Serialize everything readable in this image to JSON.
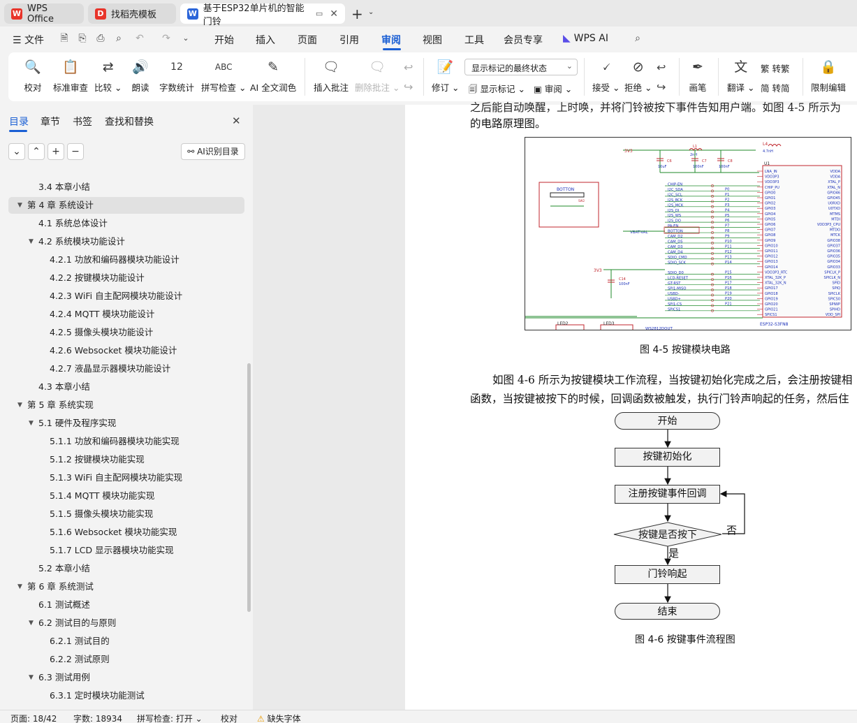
{
  "tabs": [
    {
      "label": "WPS Office",
      "logo": "W",
      "color": "#e8342a"
    },
    {
      "label": "找稻壳模板",
      "logo": "D",
      "color": "#e8342a"
    },
    {
      "label": "基于ESP32单片机的智能门铃",
      "logo": "W",
      "color": "#2b65d9"
    }
  ],
  "menu": {
    "file": "文件",
    "items": [
      "开始",
      "插入",
      "页面",
      "引用",
      "审阅",
      "视图",
      "工具",
      "会员专享"
    ],
    "wps_ai": "WPS AI"
  },
  "ribbon": {
    "proofread": "校对",
    "standard_review": "标准审查",
    "compare": "比较",
    "read_aloud": "朗读",
    "word_count": "字数统计",
    "spell_check": "拼写检查",
    "ai_polish": "AI 全文润色",
    "insert_comment": "插入批注",
    "delete_comment": "删除批注",
    "revise": "修订",
    "markup_select": "显示标记的最终状态",
    "show_markup": "显示标记",
    "review": "审阅",
    "accept": "接受",
    "reject": "拒绝",
    "brush": "画笔",
    "translate": "翻译",
    "to_traditional": "转繁",
    "to_simplified": "转简",
    "restrict_edit": "限制编辑",
    "abc_icon_text": "ABC",
    "count_icon_text": "12"
  },
  "panel": {
    "tabs": [
      "目录",
      "章节",
      "书签",
      "查找和替换"
    ],
    "ai_toc": "AI识别目录",
    "toc": [
      {
        "text": "3.4   本章小结",
        "level": 1,
        "caret": ""
      },
      {
        "text": "第 4 章    系统设计",
        "level": 0,
        "caret": "▼",
        "selected": true
      },
      {
        "text": "4.1    系统总体设计",
        "level": 1,
        "caret": ""
      },
      {
        "text": "4.2    系统模块功能设计",
        "level": 1,
        "caret": "▼"
      },
      {
        "text": "4.2.1    功放和编码器模块功能设计",
        "level": 2,
        "caret": ""
      },
      {
        "text": "4.2.2    按键模块功能设计",
        "level": 2,
        "caret": ""
      },
      {
        "text": "4.2.3    WiFi 自主配网模块功能设计",
        "level": 2,
        "caret": ""
      },
      {
        "text": "4.2.4    MQTT 模块功能设计",
        "level": 2,
        "caret": ""
      },
      {
        "text": "4.2.5    摄像头模块功能设计",
        "level": 2,
        "caret": ""
      },
      {
        "text": "4.2.6    Websocket 模块功能设计",
        "level": 2,
        "caret": ""
      },
      {
        "text": "4.2.7    液晶显示器模块功能设计",
        "level": 2,
        "caret": ""
      },
      {
        "text": "4.3    本章小结",
        "level": 1,
        "caret": ""
      },
      {
        "text": "第 5 章    系统实现",
        "level": 0,
        "caret": "▼"
      },
      {
        "text": "5.1    硬件及程序实现",
        "level": 1,
        "caret": "▼"
      },
      {
        "text": "5.1.1  功放和编码器模块功能实现",
        "level": 2,
        "caret": ""
      },
      {
        "text": "5.1.2    按键模块功能实现",
        "level": 2,
        "caret": ""
      },
      {
        "text": "5.1.3    WiFi 自主配网模块功能实现",
        "level": 2,
        "caret": ""
      },
      {
        "text": "5.1.4    MQTT 模块功能实现",
        "level": 2,
        "caret": ""
      },
      {
        "text": "5.1.5    摄像头模块功能实现",
        "level": 2,
        "caret": ""
      },
      {
        "text": "5.1.6    Websocket 模块功能实现",
        "level": 2,
        "caret": ""
      },
      {
        "text": "5.1.7    LCD 显示器模块功能实现",
        "level": 2,
        "caret": ""
      },
      {
        "text": "5.2    本章小结",
        "level": 1,
        "caret": ""
      },
      {
        "text": "第 6 章    系统测试",
        "level": 0,
        "caret": "▼"
      },
      {
        "text": "6.1    测试概述",
        "level": 1,
        "caret": ""
      },
      {
        "text": "6.2    测试目的与原则",
        "level": 1,
        "caret": "▼"
      },
      {
        "text": "6.2.1    测试目的",
        "level": 2,
        "caret": ""
      },
      {
        "text": "6.2.2    测试原则",
        "level": 2,
        "caret": ""
      },
      {
        "text": "6.3    测试用例",
        "level": 1,
        "caret": "▼"
      },
      {
        "text": "6.3.1    定时模块功能测试",
        "level": 2,
        "caret": ""
      }
    ]
  },
  "document": {
    "top_line_partial": "之后能自动唤醒，上时唤，并将门铃被按下事件告知用户端。如图 4-5 所示为",
    "line_circuit": "的电路原理图。",
    "fig45_caption": "图 4-5    按键模块电路",
    "para1_line1": "如图 4-6 所示为按键模块工作流程，当按键初始化完成之后，会注册按键相",
    "para1_line2": "函数，当按键被按下的时候，回调函数被触发，执行门铃声响起的任务，然后住",
    "flow": {
      "start": "开始",
      "init": "按键初始化",
      "register": "注册按键事件回调",
      "decision": "按键是否按下",
      "no": "否",
      "yes": "是",
      "ring": "门铃响起",
      "end": "结束"
    },
    "fig46_caption": "图 4-6    按键事件流程图",
    "schematic": {
      "chip_label": "U1",
      "chip_name": "ESP32-S3FN8",
      "button_label": "BOTTON",
      "sw_label": "SW2",
      "power": "3V3",
      "l1": "L1",
      "l1_value": "2nH",
      "l4": "L4",
      "l4_value": "4.7nH",
      "c6": "C6",
      "c6_value": "10uF",
      "c7": "C7",
      "c7_value": "100nF",
      "c8": "C8",
      "c8_value": "100nF",
      "c14": "C14",
      "c14_value": "100nF",
      "vbat": "VBAT-VAL",
      "led2": "LED2",
      "led3": "LED3",
      "ws": "WS2812DOUT",
      "nets": [
        "CHIP-EN",
        "I2C_SDA",
        "I2C_SCL",
        "I2S_BCK",
        "I2S_MCK",
        "I2S_DI",
        "I2S_WS",
        "I2S_DO",
        "PA-EN",
        "BOTTON",
        "CAM_D2",
        "CAM_D5",
        "CAM_D3",
        "CAM_D4",
        "SDIO_CMD",
        "SDIO_SCK",
        "",
        "SDIO_D0",
        "LCD-RESET",
        "GT-RST",
        "SPI1-MISO",
        "USBD-",
        "USBD+",
        "SPI1-CS",
        "SPICS1"
      ],
      "pins_p": [
        "P0",
        "P1",
        "P2",
        "P3",
        "P4",
        "P5",
        "P6",
        "P7",
        "P8",
        "P9",
        "P10",
        "P11",
        "P12",
        "P13",
        "P14",
        "",
        "P15",
        "P16",
        "P17",
        "P18",
        "P19",
        "P20",
        "P21"
      ],
      "pin_left": [
        "LNA_IN",
        "VDD3P3",
        "VDD3P3",
        "CHIP_PU",
        "GPIO0",
        "GPIO1",
        "GPIO2",
        "GPIO3",
        "GPIO4",
        "GPIO5",
        "GPIO6",
        "GPIO7",
        "GPIO8",
        "GPIO9",
        "GPIO10",
        "GPIO11",
        "GPIO12",
        "GPIO13",
        "GPIO14",
        "VDD3P3_RTC",
        "XTAL_32K_P",
        "XTAL_32K_N",
        "GPIO17",
        "GPIO18",
        "GPIO19",
        "GPIO20",
        "GPIO21",
        "SPICS1"
      ],
      "pin_right": [
        "VDDA",
        "VDDA",
        "XTAL_P",
        "XTAL_N",
        "GPIO46",
        "GPIO45",
        "U0RXD",
        "U0TXD",
        "MTMS",
        "MTDI",
        "VDD3P3_CPU",
        "MTDO",
        "MTCK",
        "GPIO38",
        "GPIO37",
        "GPIO36",
        "GPIO35",
        "GPIO34",
        "GPIO33",
        "SPICLK_P",
        "SPICLK_N",
        "SPID",
        "SPIQ",
        "SPICLK",
        "SPICS0",
        "SPIWP",
        "SPIHD",
        "VDD_SPI"
      ]
    }
  },
  "status": {
    "page": "页面: 18/42",
    "words": "字数: 18934",
    "spell": "拼写检查: 打开",
    "proof": "校对",
    "missing_font": "缺失字体"
  }
}
